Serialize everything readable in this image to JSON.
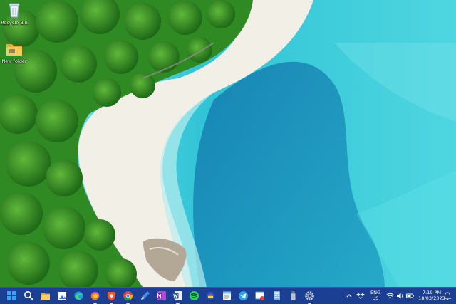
{
  "desktop": {
    "icons": [
      {
        "label": "Recycle Bin",
        "icon": "recycle-bin-icon"
      },
      {
        "label": "New folder",
        "icon": "folder-icon"
      }
    ]
  },
  "taskbar": {
    "apps": [
      "windows-start-icon",
      "search-icon",
      "file-explorer-icon",
      "photo-app-icon",
      "edge-icon",
      "firefox-icon",
      "brave-icon",
      "chrome-icon",
      "pen-app-icon",
      "onenote-icon",
      "word-icon",
      "spotify-icon",
      "app-icon",
      "notepad-icon",
      "telegram-icon",
      "snipping-tool-icon",
      "calculator-icon",
      "usb-drive-icon",
      "settings-icon"
    ],
    "tray": {
      "language_top": "ENG",
      "language_bottom": "US",
      "time": "7:19 PM",
      "date": "18/03/2023"
    }
  },
  "colors": {
    "taskbar": "#1b3f93",
    "sea": "#2fc4d6",
    "deep_sea": "#1a7fb2",
    "forest": "#2f8a23",
    "sand": "#f1efe6"
  }
}
